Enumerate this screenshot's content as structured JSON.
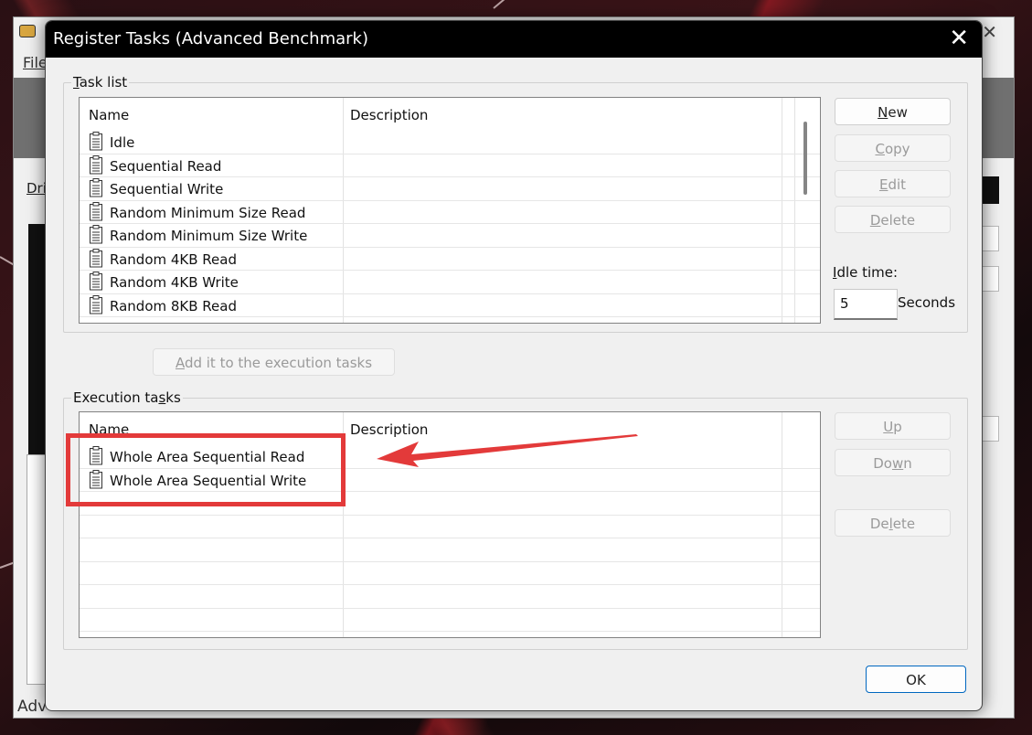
{
  "background_window": {
    "menu_file": "File",
    "drive_label": "Dri",
    "status_text": "Adv"
  },
  "dialog": {
    "title": "Register Tasks (Advanced Benchmark)",
    "close_glyph": "✕"
  },
  "task_list": {
    "legend": "Task list",
    "columns": [
      "Name",
      "Description"
    ],
    "rows": [
      {
        "name": "Idle",
        "description": ""
      },
      {
        "name": "Sequential Read",
        "description": ""
      },
      {
        "name": "Sequential Write",
        "description": ""
      },
      {
        "name": "Random Minimum Size Read",
        "description": ""
      },
      {
        "name": "Random Minimum Size Write",
        "description": ""
      },
      {
        "name": "Random 4KB Read",
        "description": ""
      },
      {
        "name": "Random 4KB Write",
        "description": ""
      },
      {
        "name": "Random 8KB Read",
        "description": ""
      }
    ]
  },
  "task_buttons": {
    "new": "New",
    "copy": "Copy",
    "edit": "Edit",
    "delete": "Delete"
  },
  "idle": {
    "label": "Idle time:",
    "value": "5",
    "unit": "Seconds"
  },
  "add_button": "Add it to the execution tasks",
  "execution_tasks": {
    "legend": "Execution tasks",
    "columns": [
      "Name",
      "Description"
    ],
    "rows": [
      {
        "name": "Whole Area Sequential Read",
        "description": ""
      },
      {
        "name": "Whole Area Sequential Write",
        "description": ""
      }
    ]
  },
  "exec_buttons": {
    "up": "Up",
    "down": "Down",
    "delete": "Delete"
  },
  "ok_button": "OK",
  "icons": {
    "task": "clipboard-icon",
    "close": "close-icon"
  },
  "colors": {
    "annotation": "#e33a3a",
    "titlebar": "#000000",
    "ok_border": "#0067c0"
  }
}
